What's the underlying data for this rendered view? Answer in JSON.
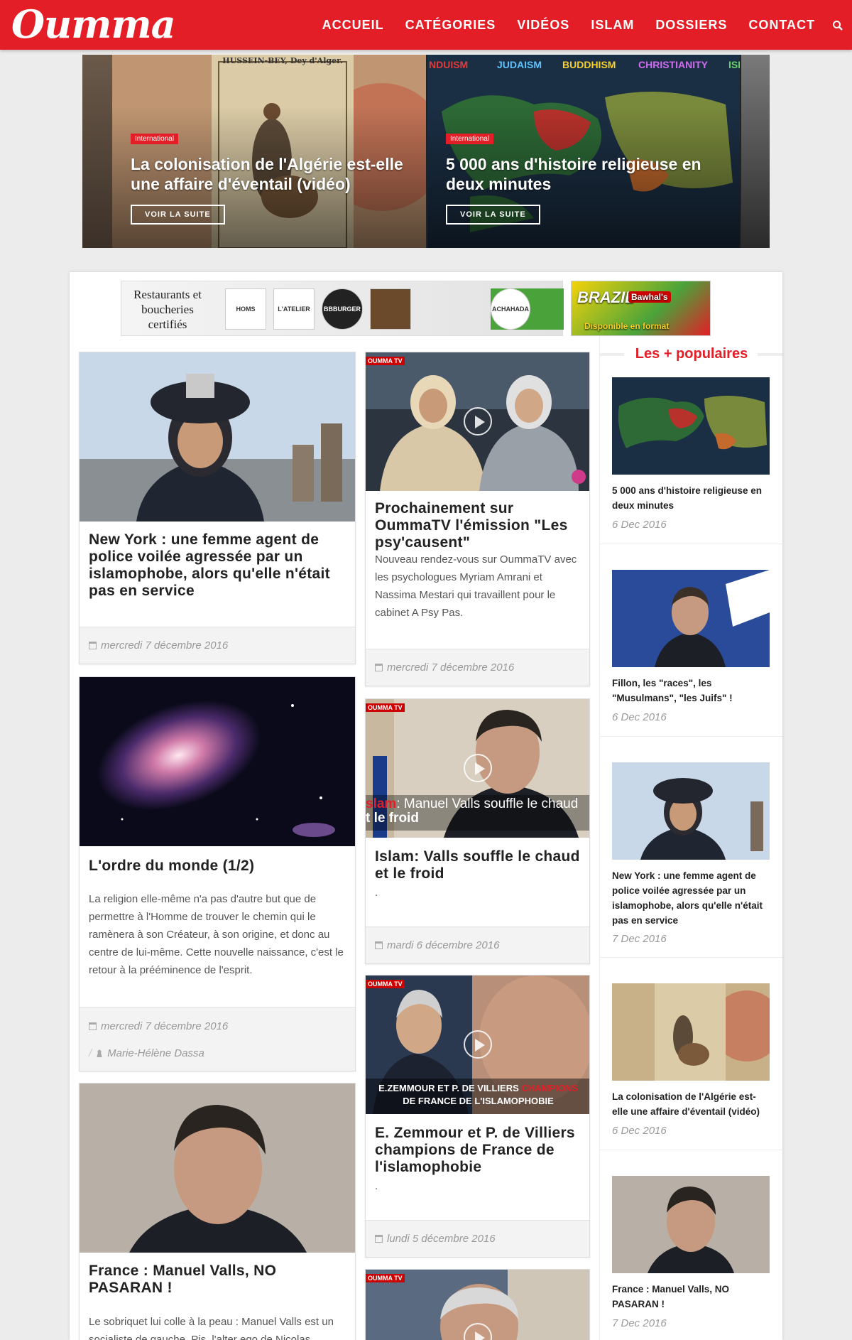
{
  "site": {
    "logo": "Oumma"
  },
  "nav": {
    "items": [
      "ACCUEIL",
      "CATÉGORIES",
      "VIDÉOS",
      "ISLAM",
      "DOSSIERS",
      "CONTACT"
    ]
  },
  "slider": {
    "slides": [
      {
        "badge": "International",
        "title": "La colonisation de l'Algérie est-elle une affaire d'éventail (vidéo)",
        "button": "VOIR LA SUITE",
        "img_caption": "HUSSEIN-BEY, Dey d'Alger."
      },
      {
        "badge": "International",
        "title": "5 000 ans d'histoire religieuse en deux minutes",
        "button": "VOIR LA SUITE",
        "img_labels": [
          "NDUISM",
          "JUDAISM",
          "BUDDHISM",
          "CHRISTIANITY",
          "ISL"
        ]
      }
    ]
  },
  "banner": {
    "text": "Restaurants et boucheries certifiés",
    "brands": [
      "HOMS",
      "L'ATELIER",
      "BBBURGER",
      "",
      "ACHAHADA"
    ],
    "ad_words": [
      "BRAZIL",
      "Bawhal's",
      "Disponible en format"
    ]
  },
  "articles": {
    "a1": {
      "title": "New York : une femme agent de police voilée agressée par un islamophobe, alors qu'elle n'était pas en service",
      "date": "mercredi 7 décembre 2016"
    },
    "a2": {
      "title": "Prochainement sur OummaTV l'émission \"Les psy'causent\"",
      "excerpt": "Nouveau rendez-vous sur OummaTV avec les psychologues Myriam Amrani et Nassima Mestari qui travaillent pour le cabinet A Psy Pas.",
      "date": "mercredi 7 décembre 2016",
      "tag": "OUMMA TV"
    },
    "a3": {
      "title": "L'ordre du monde (1/2)",
      "excerpt": "La religion elle-même n'a pas d'autre but que de permettre à l'Homme de trouver le chemin qui le ramènera à son Créateur, à son origine, et donc au centre de lui-même. Cette nouvelle naissance, c'est le retour à la prééminence de l'esprit.",
      "date": "mercredi 7 décembre 2016",
      "author": "Marie-Hélène Dassa"
    },
    "a4": {
      "title": "Islam: Valls souffle le chaud et le froid",
      "excerpt": ".",
      "date": "mardi 6 décembre 2016",
      "tag": "OUMMA TV",
      "overlay_red": "slam",
      "overlay_white": ": Manuel Valls souffle le chaud",
      "overlay_line2": "t le froid"
    },
    "a5": {
      "title": "E. Zemmour et P. de Villiers champions de France de l'islamophobie",
      "excerpt": ".",
      "date": "lundi 5 décembre 2016",
      "tag": "OUMMA TV",
      "overlay_line1_white": "E.ZEMMOUR ET P. DE VILLIERS",
      "overlay_line1_red": "CHAMPIONS",
      "overlay_line2": "DE FRANCE DE L'ISLAMOPHOBIE"
    },
    "a6": {
      "title": "France : Manuel Valls, NO PASARAN !",
      "excerpt": "Le sobriquet lui colle à la peau : Manuel Valls est un socialiste de gauche. Pis, l'alter ego de Nicolas"
    },
    "a7": {
      "tag": "OUMMA TV"
    }
  },
  "sidebar": {
    "heading": "Les + populaires",
    "items": [
      {
        "title": "5 000 ans d'histoire religieuse en deux minutes",
        "date": "6 Dec 2016"
      },
      {
        "title": "Fillon, les \"races\", les \"Musulmans\", \"les Juifs\" !",
        "date": "6 Dec 2016"
      },
      {
        "title": "New York : une femme agent de police voilée agressée par un islamophobe, alors qu'elle n'était pas en service",
        "date": "7 Dec 2016"
      },
      {
        "title": "La colonisation de l'Algérie est-elle une affaire d'éventail (vidéo)",
        "date": "6 Dec 2016"
      },
      {
        "title": "France : Manuel Valls, NO PASARAN !",
        "date": "7 Dec 2016"
      }
    ]
  },
  "colors": {
    "brand": "#e31e26",
    "date": "#999999",
    "foot_bg": "#f3f3f3"
  },
  "icons": [
    "search-icon",
    "calendar-icon",
    "user-icon",
    "play-icon"
  ]
}
